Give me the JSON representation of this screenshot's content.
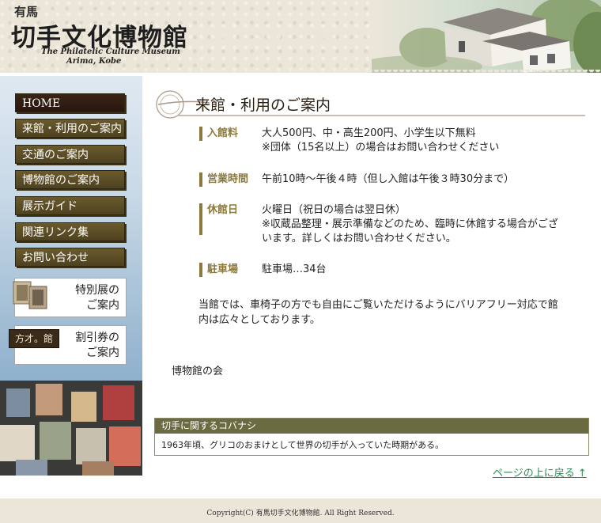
{
  "header": {
    "logo_small": "有馬",
    "logo_main": "切手文化博物館",
    "logo_en_line1": "The Philatelic Culture Museum",
    "logo_en_line2": "Arima, Kobe"
  },
  "nav": {
    "items": [
      {
        "label": "HOME"
      },
      {
        "label": "来館・利用のご案内"
      },
      {
        "label": "交通のご案内"
      },
      {
        "label": "博物館のご案内"
      },
      {
        "label": "展示ガイド"
      },
      {
        "label": "関連リンク集"
      },
      {
        "label": "お問い合わせ"
      }
    ],
    "promo1": {
      "line1": "特別展の",
      "line2": "ご案内"
    },
    "promo2": {
      "badge": "方才。館",
      "line1": "割引券の",
      "line2": "ご案内"
    }
  },
  "main": {
    "title": "来館・利用のご案内",
    "rows": [
      {
        "head": "入館料",
        "lines": [
          "大人500円、中・高生200円、小学生以下無料",
          "※団体（15名以上）の場合はお問い合わせください"
        ]
      },
      {
        "head": "営業時間",
        "lines": [
          "午前10時〜午後４時（但し入館は午後３時30分まで）"
        ]
      },
      {
        "head": "休館日",
        "lines": [
          "火曜日（祝日の場合は翌日休）",
          "※収蔵品整理・展示準備などのため、臨時に休館する場合がござ",
          "います。詳しくはお問い合わせください。"
        ]
      },
      {
        "head": "駐車場",
        "lines": [
          "駐車場…34台"
        ]
      }
    ],
    "barrier_free": [
      "当館では、車椅子の方でも自由にご覧いただけるようにバリアフリー対応で館",
      "内は広々としております。"
    ],
    "society": "博物館の会",
    "tidbit_head": "切手に関するコバナシ",
    "tidbit_body": "1963年頃、グリコのおまけとして世界の切手が入っていた時期がある。",
    "page_top": "ページの上に戻る ↑"
  },
  "footer": {
    "copyright": "Copyright(C) 有馬切手文化博物館. All Right Reserved."
  }
}
